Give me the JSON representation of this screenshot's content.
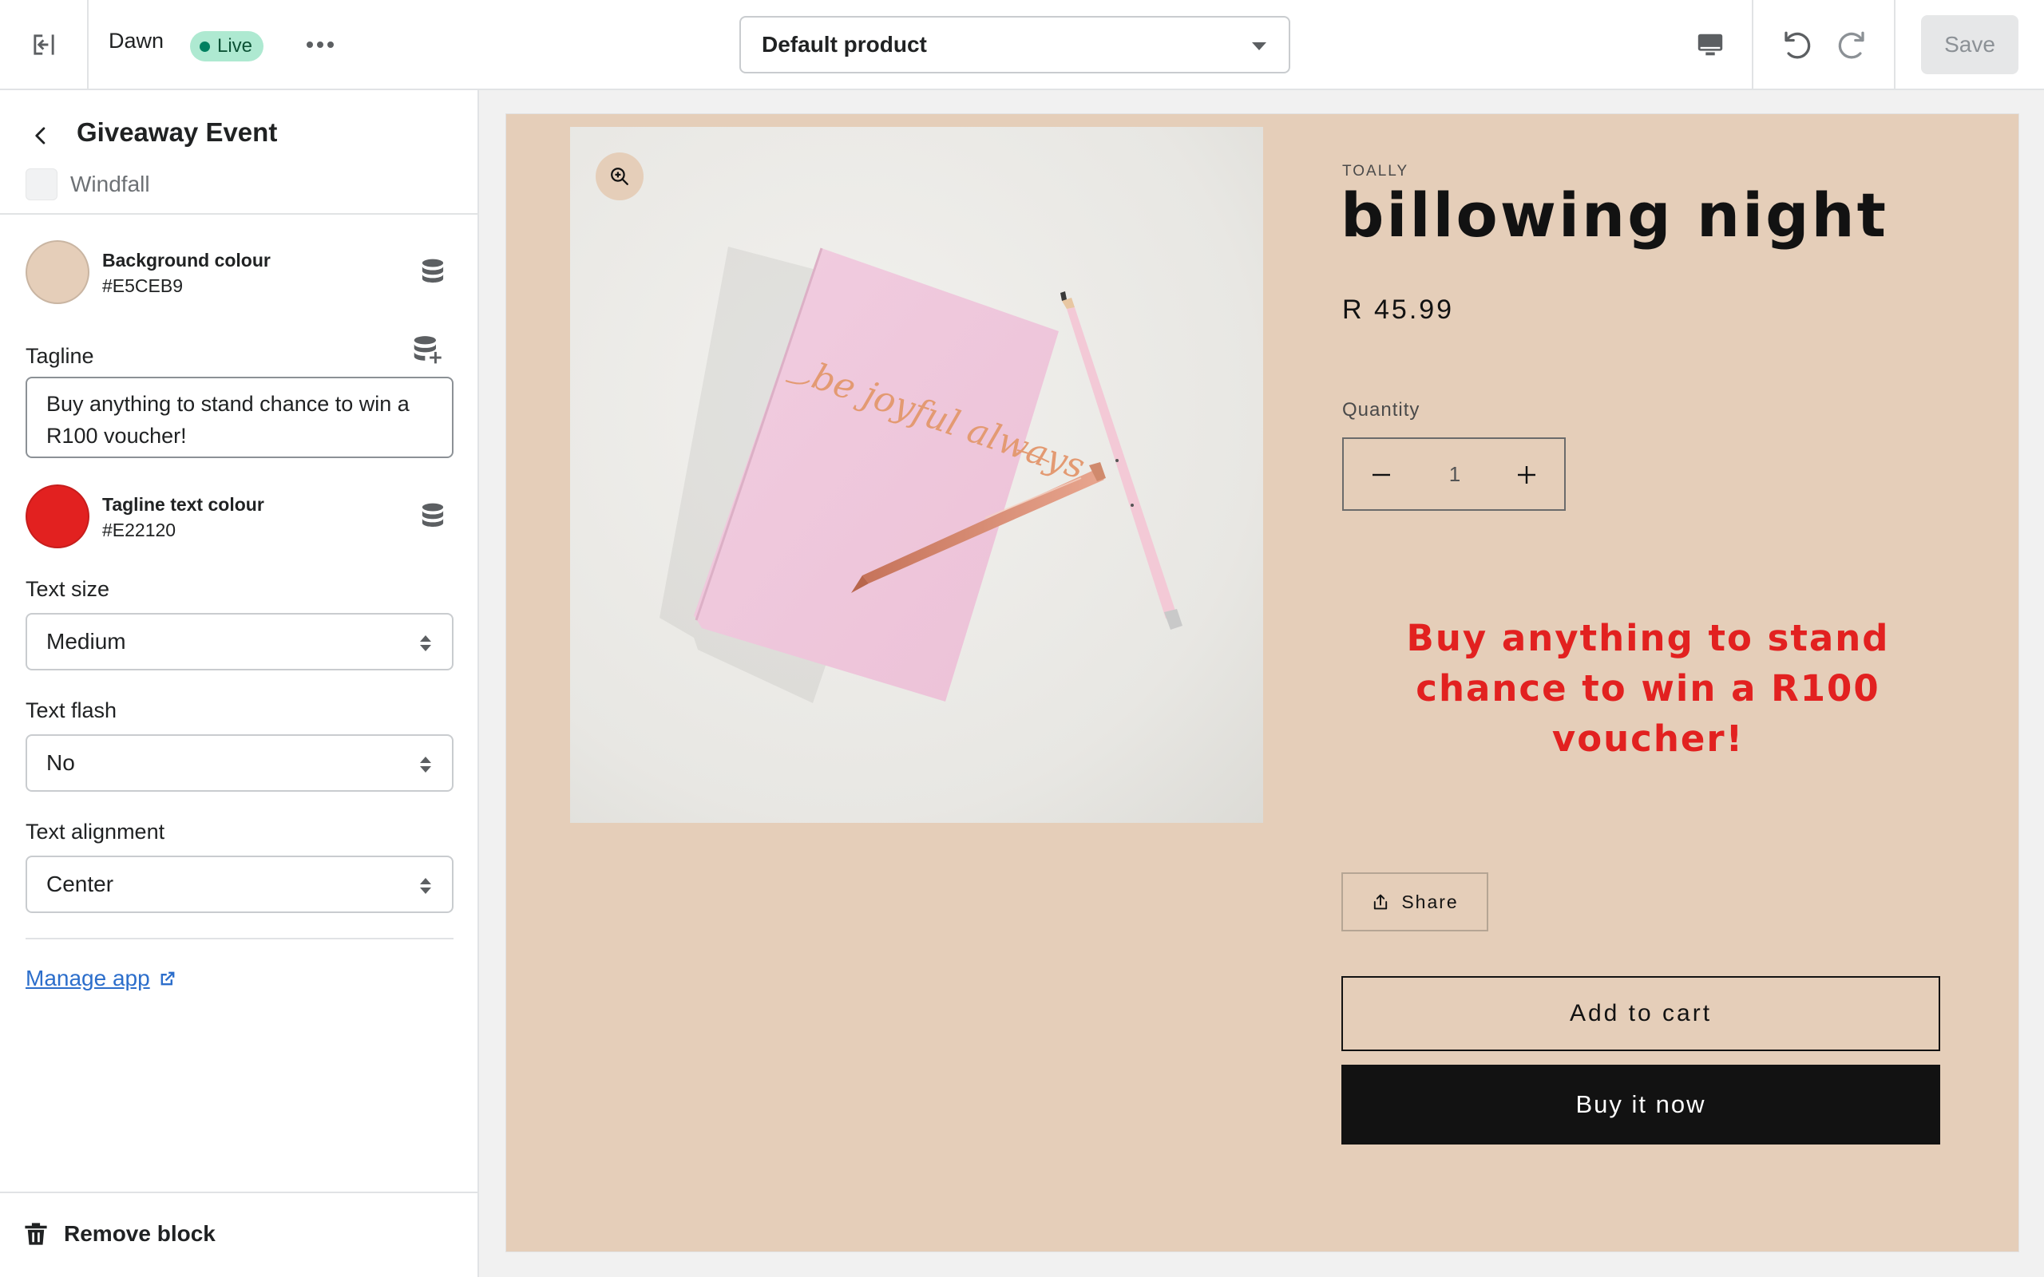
{
  "topbar": {
    "theme_name": "Dawn",
    "live_label": "Live",
    "template_select": "Default product",
    "save_label": "Save"
  },
  "sidebar": {
    "block_title": "Giveaway Event",
    "app_name": "Windfall",
    "background_colour": {
      "label": "Background colour",
      "hex": "#E5CEB9"
    },
    "tagline": {
      "label": "Tagline",
      "value": "Buy anything to stand chance to win a R100 voucher!"
    },
    "tagline_colour": {
      "label": "Tagline text colour",
      "hex": "#E22120"
    },
    "text_size": {
      "label": "Text size",
      "value": "Medium"
    },
    "text_flash": {
      "label": "Text flash",
      "value": "No"
    },
    "text_alignment": {
      "label": "Text alignment",
      "value": "Center"
    },
    "manage_app_label": "Manage app",
    "remove_block_label": "Remove block"
  },
  "preview": {
    "vendor": "TOALLY",
    "product_title": "billowing night",
    "price": "R 45.99",
    "quantity_label": "Quantity",
    "quantity_value": "1",
    "tagline": "Buy anything to stand chance to win a R100 voucher!",
    "share_label": "Share",
    "add_to_cart_label": "Add to cart",
    "buy_now_label": "Buy it now",
    "image_text": "be joyful always"
  },
  "colors": {
    "background_colour": "#E5CEB9",
    "tagline_text_colour": "#E22120",
    "live_badge": "#AEE9D1",
    "link": "#2C6ECB"
  },
  "icons": {
    "exit": "exit-icon",
    "more": "more-horizontal-icon",
    "device": "desktop-icon",
    "undo": "undo-icon",
    "redo": "redo-icon",
    "back": "chevron-left-icon",
    "dynamic_source": "database-icon",
    "dynamic_source_add": "database-plus-icon",
    "external": "external-link-icon",
    "trash": "trash-icon",
    "zoom": "zoom-in-icon",
    "share": "share-icon"
  }
}
